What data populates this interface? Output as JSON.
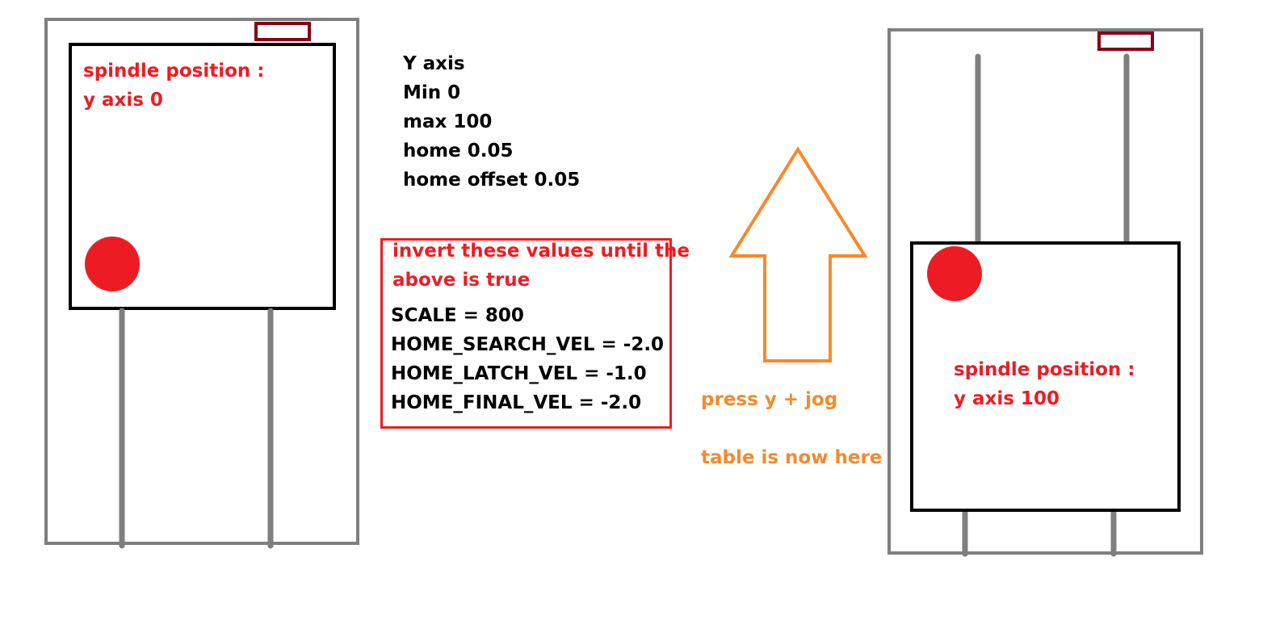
{
  "colors": {
    "frame": "#7f7f7f",
    "table": "#000000",
    "spindle": "#ed1c24",
    "sensor": "#880015",
    "arrow": "#f7892b",
    "note_border": "#ed1c24"
  },
  "left_machine": {
    "label_line1": "spindle position :",
    "label_line2": "y axis 0"
  },
  "right_machine": {
    "label_line1": "spindle position :",
    "label_line2": "y axis 100"
  },
  "axis_settings": {
    "lines": [
      "Y axis",
      "Min 0",
      "max 100",
      "home 0.05",
      "home offset 0.05"
    ]
  },
  "note": {
    "title_line1": "invert these values until the",
    "title_line2": "above is true",
    "params": [
      "SCALE = 800",
      "HOME_SEARCH_VEL = -2.0",
      "HOME_LATCH_VEL = -1.0",
      "HOME_FINAL_VEL = -2.0"
    ]
  },
  "arrow": {
    "direction": "up",
    "caption_line1": "press y + jog",
    "caption_line2": "table is now here"
  }
}
